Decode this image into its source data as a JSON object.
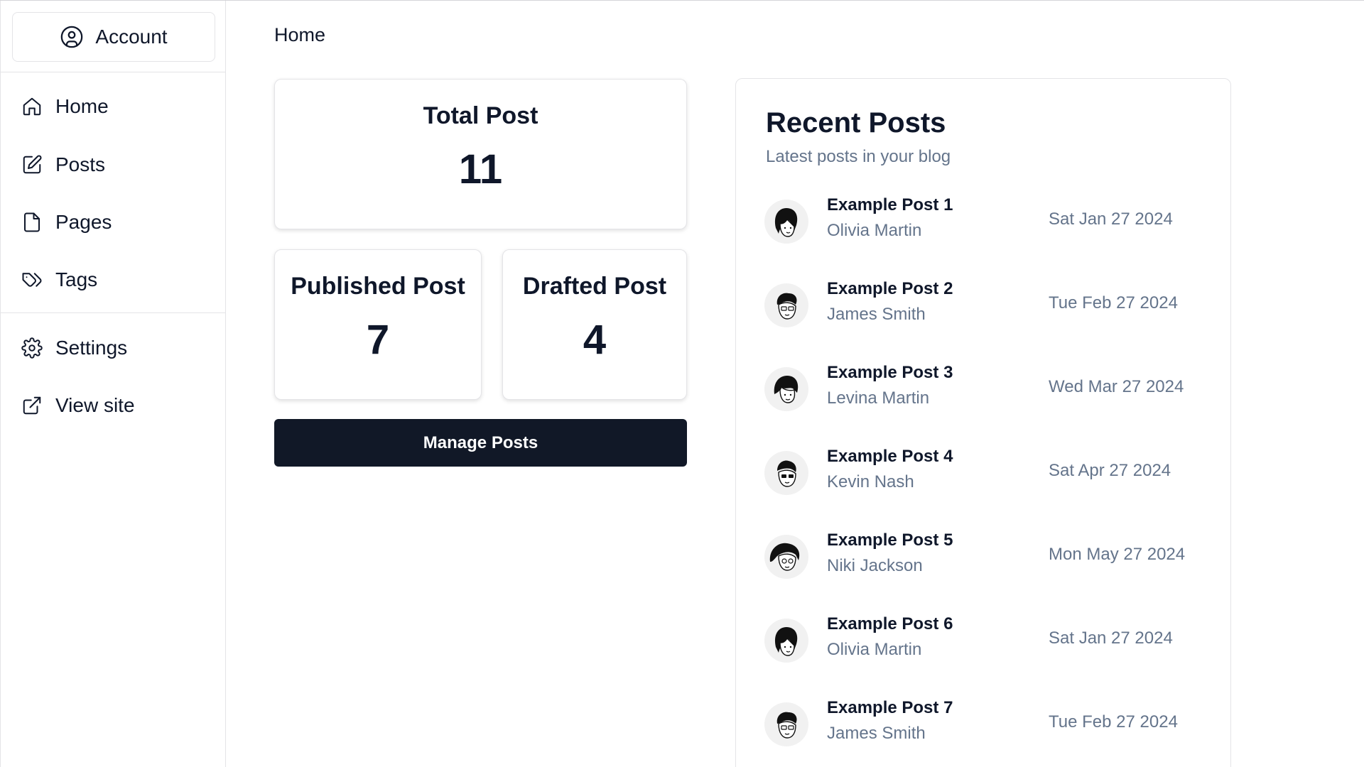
{
  "sidebar": {
    "account_label": "Account",
    "items": [
      {
        "label": "Home",
        "icon": "home-icon"
      },
      {
        "label": "Posts",
        "icon": "edit-icon"
      },
      {
        "label": "Pages",
        "icon": "file-icon"
      },
      {
        "label": "Tags",
        "icon": "tags-icon"
      },
      {
        "label": "Settings",
        "icon": "gear-icon"
      },
      {
        "label": "View site",
        "icon": "external-link-icon"
      }
    ]
  },
  "breadcrumb": "Home",
  "stats": {
    "total": {
      "label": "Total Post",
      "value": "11"
    },
    "published": {
      "label": "Published Post",
      "value": "7"
    },
    "drafted": {
      "label": "Drafted Post",
      "value": "4"
    }
  },
  "manage_button": "Manage Posts",
  "recent": {
    "title": "Recent Posts",
    "subtitle": "Latest posts in your blog",
    "posts": [
      {
        "title": "Example Post 1",
        "author": "Olivia Martin",
        "date": "Sat Jan 27 2024"
      },
      {
        "title": "Example Post 2",
        "author": "James Smith",
        "date": "Tue Feb 27 2024"
      },
      {
        "title": "Example Post 3",
        "author": "Levina Martin",
        "date": "Wed Mar 27 2024"
      },
      {
        "title": "Example Post 4",
        "author": "Kevin Nash",
        "date": "Sat Apr 27 2024"
      },
      {
        "title": "Example Post 5",
        "author": "Niki Jackson",
        "date": "Mon May 27 2024"
      },
      {
        "title": "Example Post 6",
        "author": "Olivia Martin",
        "date": "Sat Jan 27 2024"
      },
      {
        "title": "Example Post 7",
        "author": "James Smith",
        "date": "Tue Feb 27 2024"
      }
    ]
  },
  "colors": {
    "primary_button": "#111827",
    "muted_text": "#64748b",
    "border": "#e4e4e7"
  }
}
